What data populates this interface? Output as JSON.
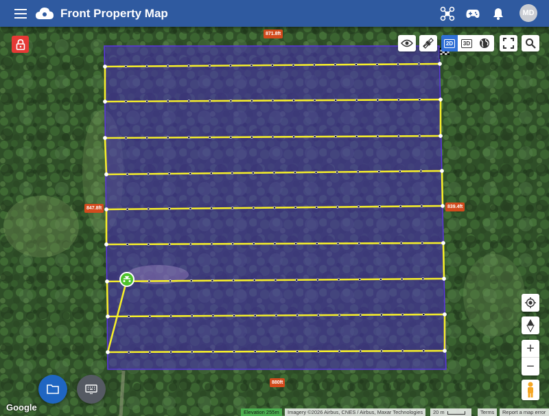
{
  "app": {
    "title": "Front Property Map",
    "user_initials": "MD"
  },
  "header_icons": [
    "menu-icon",
    "cloud-logo-icon",
    "drone-icon",
    "gamepad-icon",
    "bell-icon"
  ],
  "map_controls": {
    "view_2d": "2D",
    "view_3d": "3D",
    "active_view": "2D",
    "zoom_in": "+",
    "zoom_out": "−"
  },
  "dimensions": {
    "top": "871.8ft",
    "left": "847.8ft",
    "right": "839.4ft",
    "bottom": "880ft"
  },
  "footer": {
    "google": "Google",
    "elevation": "Elevation 255m",
    "imagery": "Imagery ©2026 Airbus, CNES / Airbus, Maxar Technologies",
    "scale": "20 m",
    "terms": "Terms",
    "report": "Report a map error"
  },
  "colors": {
    "header": "#2f5aa0",
    "polygon_fill": "#4a2dbd",
    "flight_path": "#f5ee2a",
    "dimension_label": "#d24b1d",
    "lock": "#e53935",
    "fab": "#1f66c2",
    "active_toggle": "#2f6fd6",
    "start_marker": "#4cc22a"
  }
}
